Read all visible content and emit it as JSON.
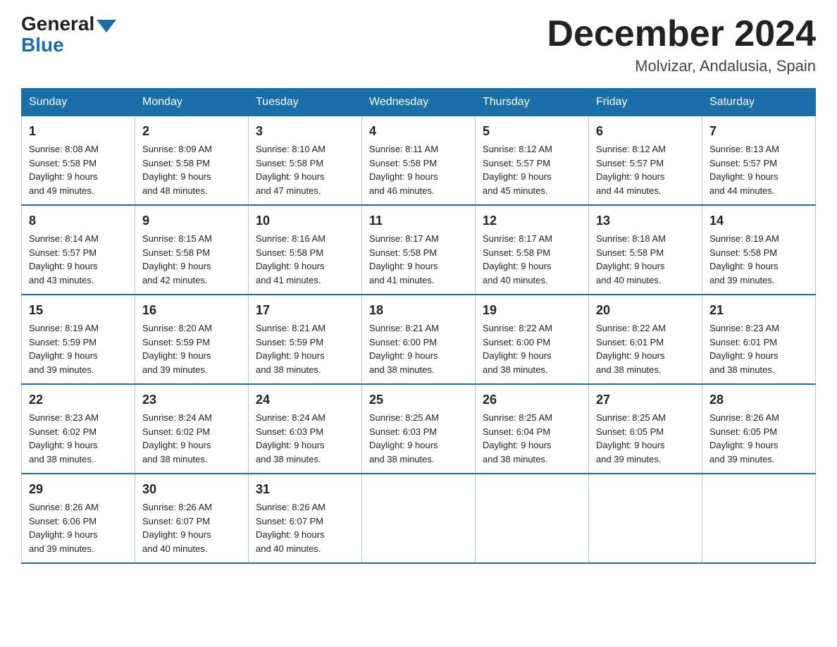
{
  "header": {
    "logo_text": "General",
    "logo_blue": "Blue",
    "month_title": "December 2024",
    "location": "Molvizar, Andalusia, Spain"
  },
  "days_of_week": [
    "Sunday",
    "Monday",
    "Tuesday",
    "Wednesday",
    "Thursday",
    "Friday",
    "Saturday"
  ],
  "weeks": [
    [
      {
        "day": "1",
        "sunrise": "8:08 AM",
        "sunset": "5:58 PM",
        "daylight": "9 hours and 49 minutes."
      },
      {
        "day": "2",
        "sunrise": "8:09 AM",
        "sunset": "5:58 PM",
        "daylight": "9 hours and 48 minutes."
      },
      {
        "day": "3",
        "sunrise": "8:10 AM",
        "sunset": "5:58 PM",
        "daylight": "9 hours and 47 minutes."
      },
      {
        "day": "4",
        "sunrise": "8:11 AM",
        "sunset": "5:58 PM",
        "daylight": "9 hours and 46 minutes."
      },
      {
        "day": "5",
        "sunrise": "8:12 AM",
        "sunset": "5:57 PM",
        "daylight": "9 hours and 45 minutes."
      },
      {
        "day": "6",
        "sunrise": "8:12 AM",
        "sunset": "5:57 PM",
        "daylight": "9 hours and 44 minutes."
      },
      {
        "day": "7",
        "sunrise": "8:13 AM",
        "sunset": "5:57 PM",
        "daylight": "9 hours and 44 minutes."
      }
    ],
    [
      {
        "day": "8",
        "sunrise": "8:14 AM",
        "sunset": "5:57 PM",
        "daylight": "9 hours and 43 minutes."
      },
      {
        "day": "9",
        "sunrise": "8:15 AM",
        "sunset": "5:58 PM",
        "daylight": "9 hours and 42 minutes."
      },
      {
        "day": "10",
        "sunrise": "8:16 AM",
        "sunset": "5:58 PM",
        "daylight": "9 hours and 41 minutes."
      },
      {
        "day": "11",
        "sunrise": "8:17 AM",
        "sunset": "5:58 PM",
        "daylight": "9 hours and 41 minutes."
      },
      {
        "day": "12",
        "sunrise": "8:17 AM",
        "sunset": "5:58 PM",
        "daylight": "9 hours and 40 minutes."
      },
      {
        "day": "13",
        "sunrise": "8:18 AM",
        "sunset": "5:58 PM",
        "daylight": "9 hours and 40 minutes."
      },
      {
        "day": "14",
        "sunrise": "8:19 AM",
        "sunset": "5:58 PM",
        "daylight": "9 hours and 39 minutes."
      }
    ],
    [
      {
        "day": "15",
        "sunrise": "8:19 AM",
        "sunset": "5:59 PM",
        "daylight": "9 hours and 39 minutes."
      },
      {
        "day": "16",
        "sunrise": "8:20 AM",
        "sunset": "5:59 PM",
        "daylight": "9 hours and 39 minutes."
      },
      {
        "day": "17",
        "sunrise": "8:21 AM",
        "sunset": "5:59 PM",
        "daylight": "9 hours and 38 minutes."
      },
      {
        "day": "18",
        "sunrise": "8:21 AM",
        "sunset": "6:00 PM",
        "daylight": "9 hours and 38 minutes."
      },
      {
        "day": "19",
        "sunrise": "8:22 AM",
        "sunset": "6:00 PM",
        "daylight": "9 hours and 38 minutes."
      },
      {
        "day": "20",
        "sunrise": "8:22 AM",
        "sunset": "6:01 PM",
        "daylight": "9 hours and 38 minutes."
      },
      {
        "day": "21",
        "sunrise": "8:23 AM",
        "sunset": "6:01 PM",
        "daylight": "9 hours and 38 minutes."
      }
    ],
    [
      {
        "day": "22",
        "sunrise": "8:23 AM",
        "sunset": "6:02 PM",
        "daylight": "9 hours and 38 minutes."
      },
      {
        "day": "23",
        "sunrise": "8:24 AM",
        "sunset": "6:02 PM",
        "daylight": "9 hours and 38 minutes."
      },
      {
        "day": "24",
        "sunrise": "8:24 AM",
        "sunset": "6:03 PM",
        "daylight": "9 hours and 38 minutes."
      },
      {
        "day": "25",
        "sunrise": "8:25 AM",
        "sunset": "6:03 PM",
        "daylight": "9 hours and 38 minutes."
      },
      {
        "day": "26",
        "sunrise": "8:25 AM",
        "sunset": "6:04 PM",
        "daylight": "9 hours and 38 minutes."
      },
      {
        "day": "27",
        "sunrise": "8:25 AM",
        "sunset": "6:05 PM",
        "daylight": "9 hours and 39 minutes."
      },
      {
        "day": "28",
        "sunrise": "8:26 AM",
        "sunset": "6:05 PM",
        "daylight": "9 hours and 39 minutes."
      }
    ],
    [
      {
        "day": "29",
        "sunrise": "8:26 AM",
        "sunset": "6:06 PM",
        "daylight": "9 hours and 39 minutes."
      },
      {
        "day": "30",
        "sunrise": "8:26 AM",
        "sunset": "6:07 PM",
        "daylight": "9 hours and 40 minutes."
      },
      {
        "day": "31",
        "sunrise": "8:26 AM",
        "sunset": "6:07 PM",
        "daylight": "9 hours and 40 minutes."
      },
      null,
      null,
      null,
      null
    ]
  ],
  "labels": {
    "sunrise": "Sunrise:",
    "sunset": "Sunset:",
    "daylight": "Daylight:"
  }
}
